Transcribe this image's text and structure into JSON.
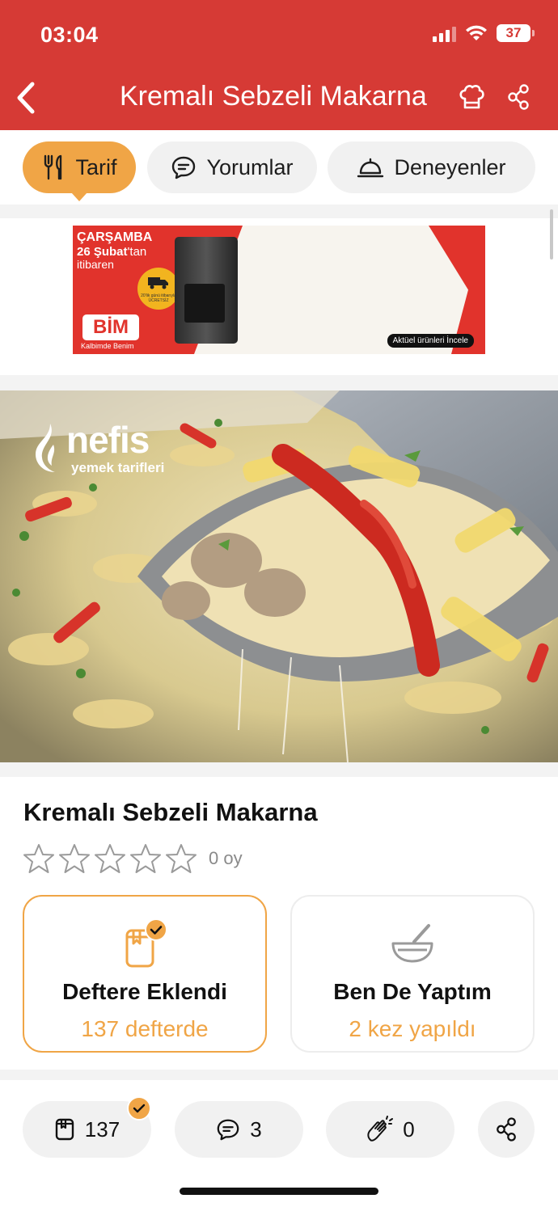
{
  "status_bar": {
    "time": "03:04",
    "battery": "37"
  },
  "header": {
    "title": "Kremalı Sebzeli Makarna",
    "icons": [
      "back-chevron-icon",
      "chef-hat-icon",
      "share-icon"
    ]
  },
  "tabs": [
    {
      "label": "Tarif",
      "icon": "fork-knife-icon",
      "active": true
    },
    {
      "label": "Yorumlar",
      "icon": "comment-icon",
      "active": false
    },
    {
      "label": "Deneyenler",
      "icon": "cloche-icon",
      "active": false
    }
  ],
  "ad": {
    "day": "ÇARŞAMBA",
    "date_bold": "26 Şubat",
    "date_rest": "'tan",
    "from": "itibaren",
    "brand": "BİM",
    "slogan": "Kalbimde Benim",
    "badge_text": "20'lik günü itibarıyla ÜCRETSİZ",
    "cta": "Aktüel ürünleri İncele"
  },
  "photo": {
    "watermark": "nefis",
    "watermark_sub": "yemek tarifleri"
  },
  "recipe": {
    "title": "Kremalı Sebzeli Makarna",
    "rating": 0,
    "votes": "0 oy"
  },
  "cards": [
    {
      "title": "Deftere Eklendi",
      "subtitle": "137 defterde",
      "icon": "notebook-check-icon",
      "active": true
    },
    {
      "title": "Ben De Yaptım",
      "subtitle": "2 kez yapıldı",
      "icon": "mortar-bowl-icon",
      "active": false
    }
  ],
  "bottom_bar": {
    "saved_count": "137",
    "comments_count": "3",
    "applause_count": "0"
  },
  "colors": {
    "header": "#d63a35",
    "accent": "#f0a546",
    "pill": "#f1f1f1"
  }
}
